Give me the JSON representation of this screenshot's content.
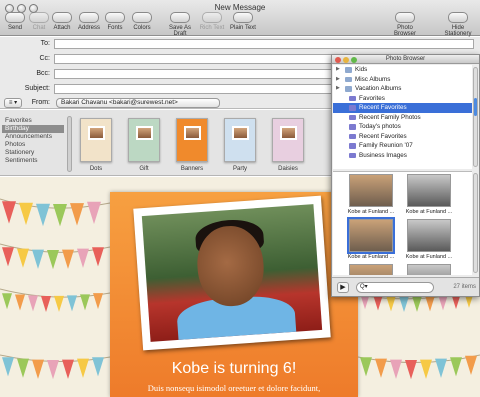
{
  "window": {
    "title": "New Message"
  },
  "toolbar": {
    "items": [
      {
        "label": "Send",
        "icon": "paper-plane-icon"
      },
      {
        "label": "Chat",
        "icon": "chat-bubble-icon"
      },
      {
        "label": "Attach",
        "icon": "paperclip-icon"
      },
      {
        "label": "Address",
        "icon": "address-book-icon"
      },
      {
        "label": "Fonts",
        "icon": "fonts-icon"
      },
      {
        "label": "Colors",
        "icon": "color-wheel-icon"
      },
      {
        "label": "Save As Draft",
        "icon": "draft-icon"
      },
      {
        "label": "Rich Text",
        "icon": "rich-text-icon"
      },
      {
        "label": "Plain Text",
        "icon": "plain-text-icon"
      },
      {
        "label": "Photo Browser",
        "icon": "photo-browser-icon"
      },
      {
        "label": "Hide Stationery",
        "icon": "stationery-icon"
      }
    ]
  },
  "header": {
    "to_label": "To:",
    "cc_label": "Cc:",
    "bcc_label": "Bcc:",
    "subject_label": "Subject:",
    "from_label": "From:",
    "from_value": "Bakari Chavanu <bakari@surewest.net>",
    "signature_glyph": "≡ ▾"
  },
  "stationery": {
    "categories": [
      "Favorites",
      "Birthday",
      "Announcements",
      "Photos",
      "Stationery",
      "Sentiments"
    ],
    "selected": "Birthday",
    "templates": [
      {
        "name": "Dots",
        "bg": "#f2e3c9"
      },
      {
        "name": "Gift",
        "bg": "#bcd8c3"
      },
      {
        "name": "Banners",
        "bg": "#f08a2c"
      },
      {
        "name": "Party",
        "bg": "#cfe0ef"
      },
      {
        "name": "Daisies",
        "bg": "#e8cfe0"
      }
    ]
  },
  "message": {
    "headline": "Kobe is turning 6!",
    "body": "Duis nonsequ isimodol oreetuer et dolore facidunt,"
  },
  "photo_browser": {
    "title": "Photo Browser",
    "sources": [
      {
        "label": "Kids",
        "folder": true
      },
      {
        "label": "Misc Albums",
        "folder": true
      },
      {
        "label": "Vacation Albums",
        "folder": true
      },
      {
        "label": "Favorites",
        "folder": false
      },
      {
        "label": "Recent Favorites",
        "folder": false,
        "selected": true
      },
      {
        "label": "Recent Family Photos",
        "folder": false
      },
      {
        "label": "Today's photos",
        "folder": false
      },
      {
        "label": "Recent Favorites",
        "folder": false
      },
      {
        "label": "Family Reunion '07",
        "folder": false
      },
      {
        "label": "Business Images",
        "folder": false
      }
    ],
    "photos": [
      {
        "label": "Kobe at Funland ...",
        "tone": "color"
      },
      {
        "label": "Kobe at Funland ...",
        "tone": "bw"
      },
      {
        "label": "Kobe at Funland ...",
        "tone": "color"
      },
      {
        "label": "Kobe at Funland ...",
        "tone": "bw"
      },
      {
        "label": "",
        "tone": "color"
      },
      {
        "label": "",
        "tone": "bw"
      }
    ],
    "search_placeholder": "Q▾",
    "count": "27 items",
    "play_glyph": "▶"
  }
}
